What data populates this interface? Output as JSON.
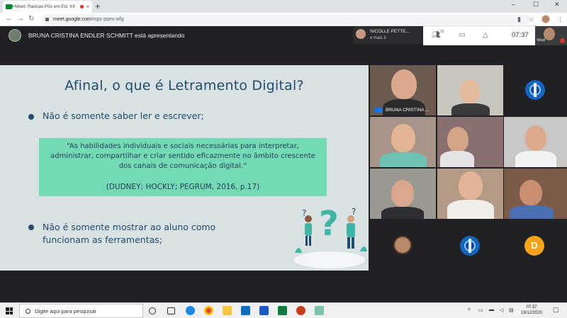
{
  "browser": {
    "tab_title": "Meet: Rancas Pós em Ed. Inf.",
    "tab_close": "×",
    "new_tab": "+",
    "window_controls": {
      "minimize": "–",
      "maximize": "☐",
      "close": "✕"
    },
    "nav": {
      "back": "←",
      "forward": "→",
      "reload": "↻"
    },
    "url_domain": "meet.google.com",
    "url_path": "/mpz-ppex-wfg",
    "menu": "⋮"
  },
  "meet": {
    "presenter_banner": "BRUNA CRISTINA ENDLER SCHMITT está apresentando",
    "mini_participant": {
      "name": "NICOLLE PETTE...",
      "more": "e mais 3"
    },
    "participant_count": "10",
    "clock": "07:37",
    "self_label": "Você",
    "icons": {
      "people": "people-icon",
      "chat": "chat-icon",
      "activities": "activities-icon",
      "info": "info-icon"
    }
  },
  "slide": {
    "title": "Afinal, o que é Letramento Digital?",
    "bullet1": "Não é somente saber ler e escrever;",
    "quote": "“As habilidades individuais e sociais necessárias para interpretar, administrar, compartilhar e criar sentido eficazmente no âmbito crescente dos canais de comunicação digital.”",
    "citation": "(DUDNEY; HOCKLY; PEGRUM, 2016, p.17)",
    "bullet2_line1": "Não é somente mostrar ao aluno como",
    "bullet2_line2": "funcionam as ferramentas;",
    "colors": {
      "background": "#d8e2e5",
      "title": "#254b6b",
      "quote_box": "#74dab4",
      "illustration": "#3fb5a3"
    }
  },
  "participants": [
    {
      "name": "BRUNA CRISTINA ...",
      "speaking": true
    },
    {
      "name": ""
    },
    {
      "name": "",
      "logo": "university-logo-icon"
    },
    {
      "name": ""
    },
    {
      "name": ""
    },
    {
      "name": ""
    },
    {
      "name": ""
    },
    {
      "name": ""
    },
    {
      "name": ""
    },
    {
      "name": "",
      "avatar": "participant-avatar"
    },
    {
      "name": "",
      "logo": "university-logo-icon"
    },
    {
      "name": "",
      "initial": "D"
    }
  ],
  "taskbar": {
    "search_placeholder": "Digite aqui para pesquisar",
    "time": "07:37",
    "date": "19/12/2020"
  }
}
